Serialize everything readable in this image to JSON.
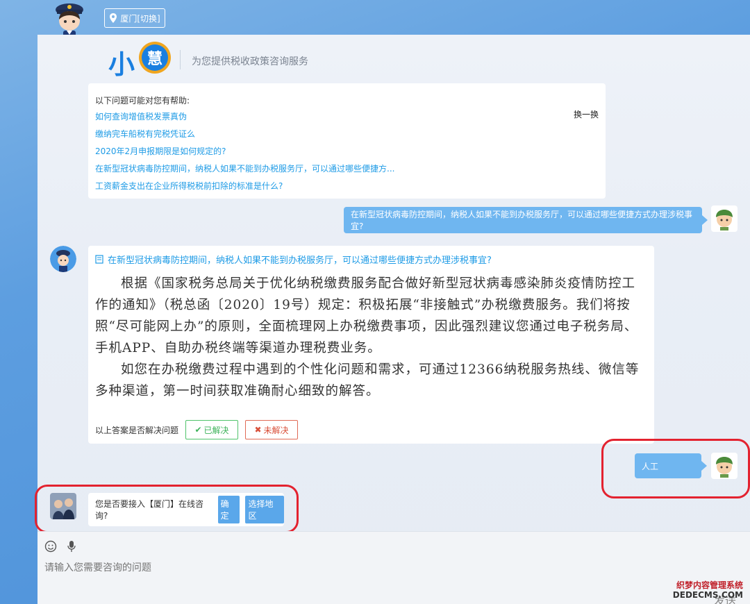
{
  "location": {
    "label": "厦门[切换]"
  },
  "header": {
    "logo_text": "小",
    "logo_badge": "慧",
    "subtitle": "为您提供税收政策咨询服务"
  },
  "suggestions": {
    "title": "以下问题可能对您有帮助:",
    "swap_label": "换一换",
    "items": [
      "如何查询增值税发票真伪",
      "缴纳完车船税有完税凭证么",
      "2020年2月申报期限是如何规定的?",
      "在新型冠状病毒防控期间，纳税人如果不能到办税服务厅，可以通过哪些便捷方...",
      "工资薪金支出在企业所得税税前扣除的标准是什么?"
    ]
  },
  "user_question": "在新型冠状病毒防控期间，纳税人如果不能到办税服务厅，可以通过哪些便捷方式办理涉税事宜?",
  "answer": {
    "question": "在新型冠状病毒防控期间，纳税人如果不能到办税服务厅，可以通过哪些便捷方式办理涉税事宜?",
    "paragraph1": "根据《国家税务总局关于优化纳税缴费服务配合做好新型冠状病毒感染肺炎疫情防控工作的通知》（税总函〔2020〕19号）规定：积极拓展“非接触式”办税缴费服务。我们将按照“尽可能网上办”的原则，全面梳理网上办税缴费事项，因此强烈建议您通过电子税务局、手机APP、自助办税终端等渠道办理税费业务。",
    "paragraph2": "如您在办税缴费过程中遇到的个性化问题和需求，可通过12366纳税服务热线、微信等多种渠道，第一时间获取准确耐心细致的解答。",
    "resolve_prompt": "以上答案是否解决问题",
    "resolved_label": "已解决",
    "unresolved_label": "未解决"
  },
  "user_message2": "人工",
  "human_prompt": {
    "text": "您是否要接入【厦门】在线咨询?",
    "confirm_label": "确定",
    "region_label": "选择地区"
  },
  "input": {
    "placeholder": "请输入您需要咨询的问题",
    "send_label": "发送"
  },
  "watermark": {
    "line1": "织梦内容管理系统",
    "line2": "DEDECMS.COM"
  },
  "colors": {
    "accent": "#1e9be6",
    "bubble": "#6fb6f0",
    "highlight": "#e3222f"
  }
}
